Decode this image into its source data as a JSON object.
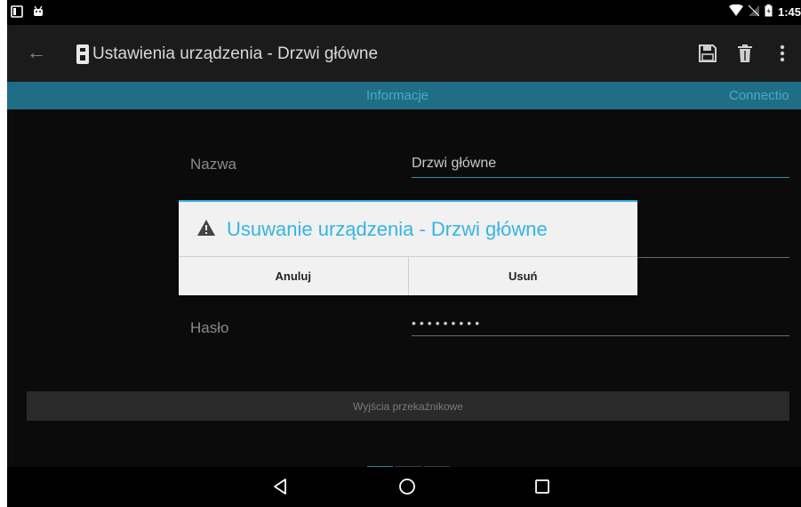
{
  "status_bar": {
    "time": "1:45"
  },
  "action_bar": {
    "title": "Ustawienia urządzenia - Drzwi główne",
    "back_icon": "arrow-back-icon",
    "save_icon": "floppy-disk-icon",
    "delete_icon": "trash-icon",
    "menu_icon": "overflow-menu-icon"
  },
  "tabs": [
    {
      "label": "Informacje"
    },
    {
      "label": "Connectio"
    }
  ],
  "form": {
    "name_label": "Nazwa",
    "name_value": "Drzwi główne",
    "password_label": "Hasło",
    "password_value": "•••••••••"
  },
  "relay_button": {
    "label": "Wyjścia przekaźnikowe"
  },
  "pager": {
    "pages": 3,
    "active": 1
  },
  "dialog": {
    "title": "Usuwanie urządzenia - Drzwi główne",
    "icon": "warning-icon",
    "cancel_label": "Anuluj",
    "confirm_label": "Usuń"
  },
  "colors": {
    "accent": "#33b5e5",
    "tab_bar": "#1f6e86",
    "action_bar": "#1b1b1b",
    "dialog_bg": "#f1f1f1"
  }
}
